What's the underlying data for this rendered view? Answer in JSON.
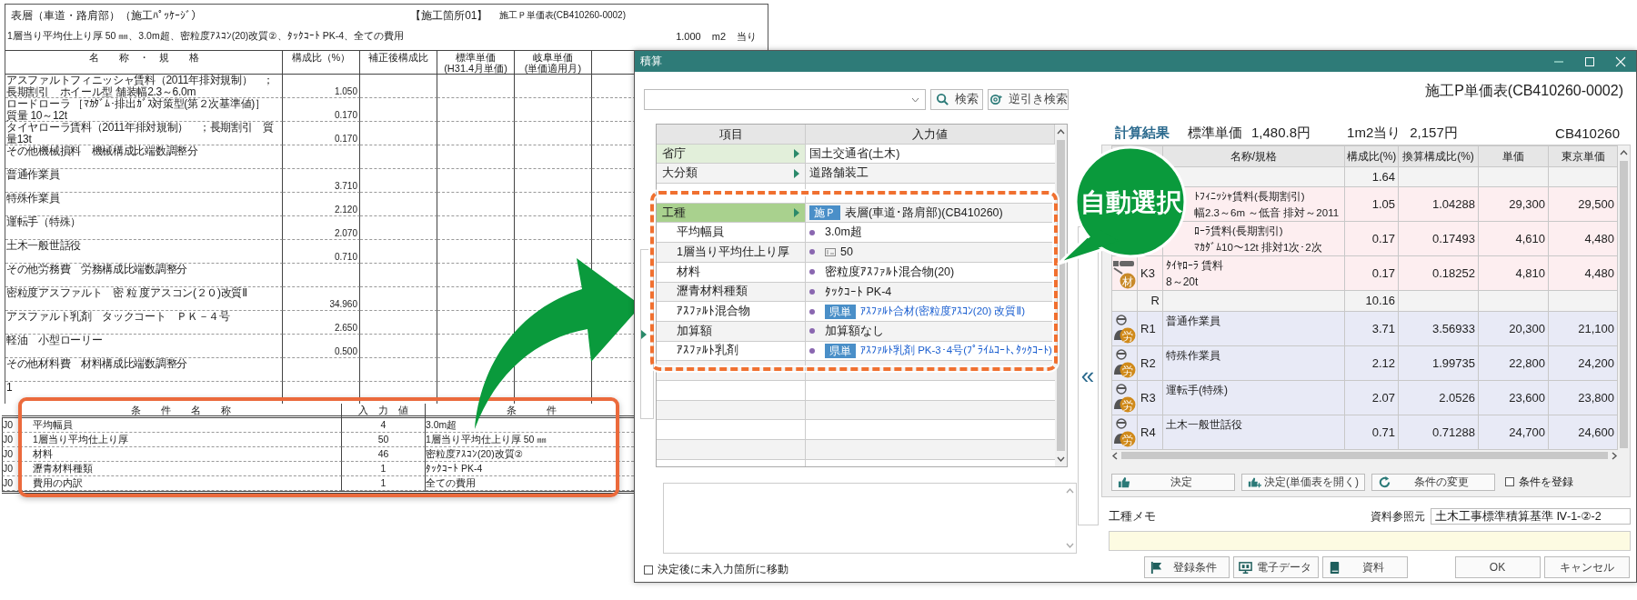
{
  "document": {
    "title": "表層（車道・路肩部）（施工ﾊﾟｯｹｰｼﾞ）",
    "location": "【施工箇所01】",
    "sheet_id": "施工Ｐ単価表(CB410260-0002)",
    "summary": "1層当り平均仕上り厚 50 ㎜、3.0m超、密粒度ｱｽｺﾝ(20)改質②、ﾀｯｸｺｰﾄ PK-4、全ての費用",
    "quantity": "1.000",
    "unit": "m2",
    "per": "当り",
    "columns": [
      {
        "lines": [
          "名　　称　・　規　　格"
        ]
      },
      {
        "lines": [
          "構成比（%）"
        ]
      },
      {
        "lines": [
          "補正後構成比"
        ]
      },
      {
        "lines": [
          "標準単価",
          "(H31.4月単価)"
        ]
      },
      {
        "lines": [
          "岐阜単価",
          "(単価適用月)"
        ]
      }
    ],
    "rows": [
      {
        "lines": [
          "アスファルトフィニッシャ賃料（2011年排対規制）　；",
          "長期割引　ホイール型 舗装幅2.3～6.0m"
        ],
        "ratio": "1.050"
      },
      {
        "lines": [
          "ロードローラ ［ﾏｶﾀﾞﾑ･排出ｶﾞｽ対策型(第２次基準値)］",
          "質量 10～12t"
        ],
        "ratio": "0.170"
      },
      {
        "lines": [
          "タイヤローラ賃料（2011年排対規制）　；長期割引　質量13t"
        ],
        "ratio": "0.170"
      },
      {
        "lines": [
          "その他機械損料　機械構成比端数調整分"
        ]
      },
      {
        "lines": [
          "普通作業員"
        ],
        "ratio": "3.710"
      },
      {
        "lines": [
          "特殊作業員"
        ],
        "ratio": "2.120"
      },
      {
        "lines": [
          "運転手（特殊）"
        ],
        "ratio": "2.070"
      },
      {
        "lines": [
          "土木一般世話役"
        ],
        "ratio": "0.710"
      },
      {
        "lines": [
          "その他労務費　労務構成比端数調整分"
        ]
      },
      {
        "lines": [
          "密粒度アスファルト　密 粒 度アスコン(２０)改質Ⅱ"
        ],
        "ratio": "34.960"
      },
      {
        "lines": [
          "アスファルト乳剤　タックコート　ＰＫ－４号"
        ],
        "ratio": "2.650"
      },
      {
        "lines": [
          "軽油　小型ローリー"
        ],
        "ratio": "0.500"
      },
      {
        "lines": [
          "その他材料費　材料構成比端数調整分"
        ]
      }
    ],
    "total_row": "1",
    "condition_table": {
      "columns": [
        "条　　件　　名　　称",
        "入　力　値",
        "条　　　件"
      ],
      "rows": [
        {
          "code": "J0",
          "name": "平均幅員",
          "value": "4",
          "condition": "3.0m超"
        },
        {
          "code": "J0",
          "name": "1層当り平均仕上り厚",
          "value": "50",
          "condition": "1層当り平均仕上り厚 50 ㎜"
        },
        {
          "code": "J0",
          "name": "材料",
          "value": "46",
          "condition": "密粒度ｱｽｺﾝ(20)改質②"
        },
        {
          "code": "J0",
          "name": "瀝青材料種類",
          "value": "1",
          "condition": "ﾀｯｸｺｰﾄ PK-4"
        },
        {
          "code": "J0",
          "name": "費用の内訳",
          "value": "1",
          "condition": "全ての費用"
        }
      ]
    }
  },
  "window": {
    "title": "積算",
    "search_buttons": [
      {
        "label": "検索",
        "kind": "search"
      },
      {
        "label": "逆引き検索",
        "kind": "reverse"
      }
    ],
    "input_grid": {
      "columns": [
        "項目",
        "入力値"
      ],
      "rows": [
        {
          "kind": "category",
          "label": "省庁",
          "value": "国土交通省(土木)",
          "selected": false
        },
        {
          "kind": "category",
          "label": "大分類",
          "value": "道路舗装工",
          "selected": false
        },
        {
          "kind": "covered"
        },
        {
          "kind": "category",
          "label": "工種",
          "tag": "施Ｐ",
          "value": "表層(車道･路肩部)(CB410260)",
          "selected": true
        },
        {
          "kind": "condition",
          "label": "平均幅員",
          "value": "3.0m超",
          "linked": false,
          "numeric_input": false
        },
        {
          "kind": "condition",
          "label": "1層当り平均仕上り厚",
          "value": "50",
          "linked": false,
          "numeric_input": true
        },
        {
          "kind": "condition",
          "label": "材料",
          "value": "密粒度ｱｽﾌｧﾙﾄ混合物(20)",
          "linked": false,
          "numeric_input": false
        },
        {
          "kind": "condition",
          "label": "瀝青材料種類",
          "value": "ﾀｯｸｺｰﾄ PK-4",
          "linked": false,
          "numeric_input": false
        },
        {
          "kind": "condition",
          "label": "ｱｽﾌｧﾙﾄ混合物",
          "tag": "県単",
          "value": "ｱｽﾌｧﾙﾄ合材(密粒度ｱｽｺﾝ(20) 改質Ⅱ)",
          "linked": true,
          "numeric_input": false
        },
        {
          "kind": "condition",
          "label": "加算額",
          "value": "加算額なし",
          "linked": false,
          "numeric_input": false
        },
        {
          "kind": "condition",
          "label": "ｱｽﾌｧﾙﾄ乳剤",
          "tag": "県単",
          "value": "ｱｽﾌｧﾙﾄ乳剤 PK-3･4号(ﾌﾟﾗｲﾑｺｰﾄ､ﾀｯｸｺｰﾄ)",
          "linked": true,
          "numeric_input": false
        },
        {
          "kind": "covered"
        }
      ]
    },
    "move_checkbox": {
      "label": "決定後に未入力箇所に移動",
      "checked": false
    },
    "collapse_button": "«",
    "header_title": "施工P単価表(CB410260-0002)",
    "summary": {
      "label": "計算結果",
      "standard_label": "標準単価",
      "standard_price": "1,480.8円",
      "per_label": "1m2当り",
      "per_price": "2,157円",
      "code": "CB410260"
    },
    "result_table": {
      "columns": [
        "名称/規格",
        "構成比(%)",
        "換算構成比(%)",
        "単価",
        "東京単価"
      ],
      "rows": [
        {
          "kind": "group",
          "ratio": "1.64"
        },
        {
          "kind": "machine",
          "lines": [
            "ﾄﾌｨﾆｯｼｬ賃料(長期割引)",
            "幅2.3～6m ～低音 排対～2011"
          ],
          "ratio": "1.05",
          "converted": "1.04288",
          "price": "29,300",
          "tokyo": "29,500"
        },
        {
          "kind": "machine",
          "lines": [
            "ﾛｰﾗ賃料(長期割引)",
            "ﾏｶﾀﾞﾑ10～12t 排対1次･2次"
          ],
          "ratio": "0.17",
          "converted": "0.17493",
          "price": "4,610",
          "tokyo": "4,480"
        },
        {
          "kind": "machine",
          "code": "K3",
          "badge": "材",
          "lines": [
            "ﾀｲﾔﾛｰﾗ 賃料",
            "8～20t"
          ],
          "ratio": "0.17",
          "converted": "0.18252",
          "price": "4,810",
          "tokyo": "4,480"
        },
        {
          "kind": "group",
          "code": "R",
          "ratio": "10.16"
        },
        {
          "kind": "labor",
          "code": "R1",
          "badge": "労",
          "lines": [
            "普通作業員"
          ],
          "ratio": "3.71",
          "converted": "3.56933",
          "price": "20,300",
          "tokyo": "21,100"
        },
        {
          "kind": "labor",
          "code": "R2",
          "badge": "労",
          "lines": [
            "特殊作業員"
          ],
          "ratio": "2.12",
          "converted": "1.99735",
          "price": "22,800",
          "tokyo": "24,200"
        },
        {
          "kind": "labor",
          "code": "R3",
          "badge": "労",
          "lines": [
            "運転手(特殊)"
          ],
          "ratio": "2.07",
          "converted": "2.0526",
          "price": "23,600",
          "tokyo": "23,800"
        },
        {
          "kind": "labor",
          "code": "R4",
          "badge": "労",
          "lines": [
            "土木一般世話役"
          ],
          "ratio": "0.71",
          "converted": "0.71288",
          "price": "24,700",
          "tokyo": "24,600"
        }
      ]
    },
    "actions": [
      {
        "label": "決定",
        "kind": "thumb"
      },
      {
        "label": "決定(単価表を開く)",
        "kind": "thumb-plus"
      },
      {
        "label": "条件の変更",
        "kind": "refresh"
      }
    ],
    "register_checkbox": {
      "label": "条件を登録",
      "checked": false
    },
    "memo_label": "工種メモ",
    "reference": {
      "label": "資料参照元",
      "value": "土木工事標準積算基準 Ⅳ-1-②-2"
    },
    "footer_buttons": [
      {
        "label": "登録条件",
        "kind": "flag"
      },
      {
        "label": "電子データ",
        "kind": "monitor"
      },
      {
        "label": "資料",
        "kind": "book"
      },
      {
        "label": "OK",
        "kind": "plain"
      },
      {
        "label": "キャンセル",
        "kind": "plain"
      }
    ]
  },
  "callout": "自動選択"
}
